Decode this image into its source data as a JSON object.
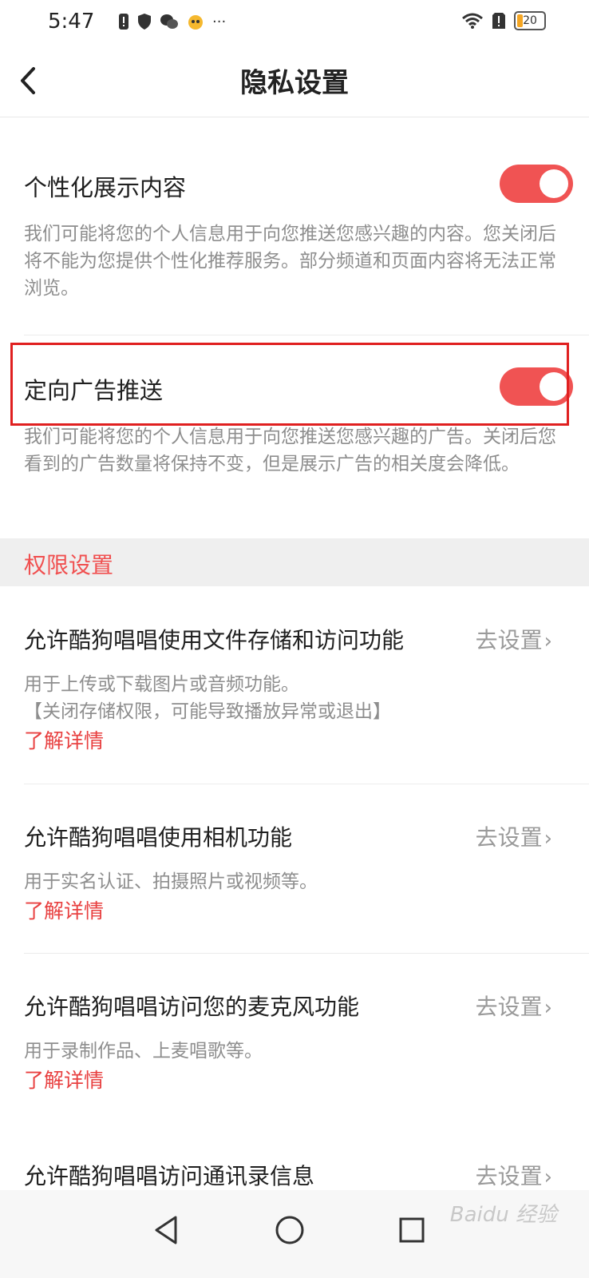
{
  "status_bar": {
    "time": "5:47",
    "battery": "20",
    "more": "···"
  },
  "header": {
    "title": "隐私设置"
  },
  "privacy": {
    "personalized": {
      "title": "个性化展示内容",
      "desc": "我们可能将您的个人信息用于向您推送您感兴趣的内容。您关闭后将不能为您提供个性化推荐服务。部分频道和页面内容将无法正常浏览。",
      "enabled": true
    },
    "targeted_ads": {
      "title": "定向广告推送",
      "desc": "我们可能将您的个人信息用于向您推送您感兴趣的广告。关闭后您看到的广告数量将保持不变，但是展示广告的相关度会降低。",
      "enabled": true
    }
  },
  "permissions": {
    "header": "权限设置",
    "goto_label": "去设置",
    "learn_more": "了解详情",
    "items": [
      {
        "title": "允许酷狗唱唱使用文件存储和访问功能",
        "desc": "用于上传或下载图片或音频功能。",
        "note": "【关闭存储权限，可能导致播放异常或退出】"
      },
      {
        "title": "允许酷狗唱唱使用相机功能",
        "desc": "用于实名认证、拍摄照片或视频等。"
      },
      {
        "title": "允许酷狗唱唱访问您的麦克风功能",
        "desc": "用于录制作品、上麦唱歌等。"
      },
      {
        "title": "允许酷狗唱唱访问通讯录信息"
      }
    ]
  },
  "watermark": "Baidu 经验"
}
